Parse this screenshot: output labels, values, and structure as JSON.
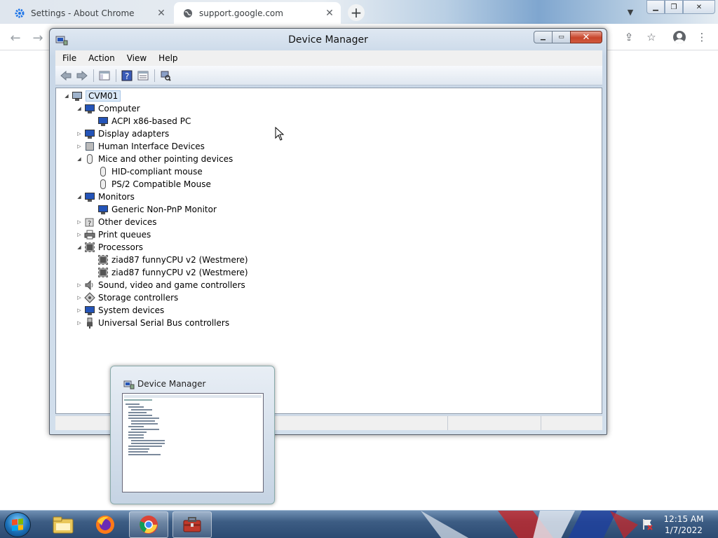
{
  "browser": {
    "tabs": [
      {
        "label": "Settings - About Chrome",
        "icon": "gear-icon"
      },
      {
        "label": "support.google.com",
        "icon": "globe-icon"
      }
    ]
  },
  "dm": {
    "title": "Device Manager",
    "menu": [
      "File",
      "Action",
      "View",
      "Help"
    ],
    "tree": {
      "root": "CVM01",
      "items": [
        {
          "label": "Computer",
          "expanded": true,
          "icon": "computer-icon",
          "children": [
            "ACPI x86-based PC"
          ]
        },
        {
          "label": "Display adapters",
          "expanded": false,
          "icon": "display-adapter-icon"
        },
        {
          "label": "Human Interface Devices",
          "expanded": false,
          "icon": "hid-icon"
        },
        {
          "label": "Mice and other pointing devices",
          "expanded": true,
          "icon": "mouse-icon",
          "children": [
            "HID-compliant mouse",
            "PS/2 Compatible Mouse"
          ]
        },
        {
          "label": "Monitors",
          "expanded": true,
          "icon": "monitor-icon",
          "children": [
            "Generic Non-PnP Monitor"
          ]
        },
        {
          "label": "Other devices",
          "expanded": false,
          "icon": "unknown-device-icon"
        },
        {
          "label": "Print queues",
          "expanded": false,
          "icon": "printer-icon"
        },
        {
          "label": "Processors",
          "expanded": true,
          "icon": "processor-icon",
          "children": [
            "ziad87 funnyCPU v2 (Westmere)",
            "ziad87 funnyCPU v2 (Westmere)"
          ]
        },
        {
          "label": "Sound, video and game controllers",
          "expanded": false,
          "icon": "speaker-icon"
        },
        {
          "label": "Storage controllers",
          "expanded": false,
          "icon": "storage-icon"
        },
        {
          "label": "System devices",
          "expanded": false,
          "icon": "system-icon"
        },
        {
          "label": "Universal Serial Bus controllers",
          "expanded": false,
          "icon": "usb-icon"
        }
      ]
    }
  },
  "thumbnail": {
    "title": "Device Manager"
  },
  "taskbar": {
    "apps": [
      "explorer-icon",
      "firefox-icon",
      "chrome-icon",
      "toolbox-icon"
    ],
    "time": "12:15 AM",
    "date": "1/7/2022"
  }
}
